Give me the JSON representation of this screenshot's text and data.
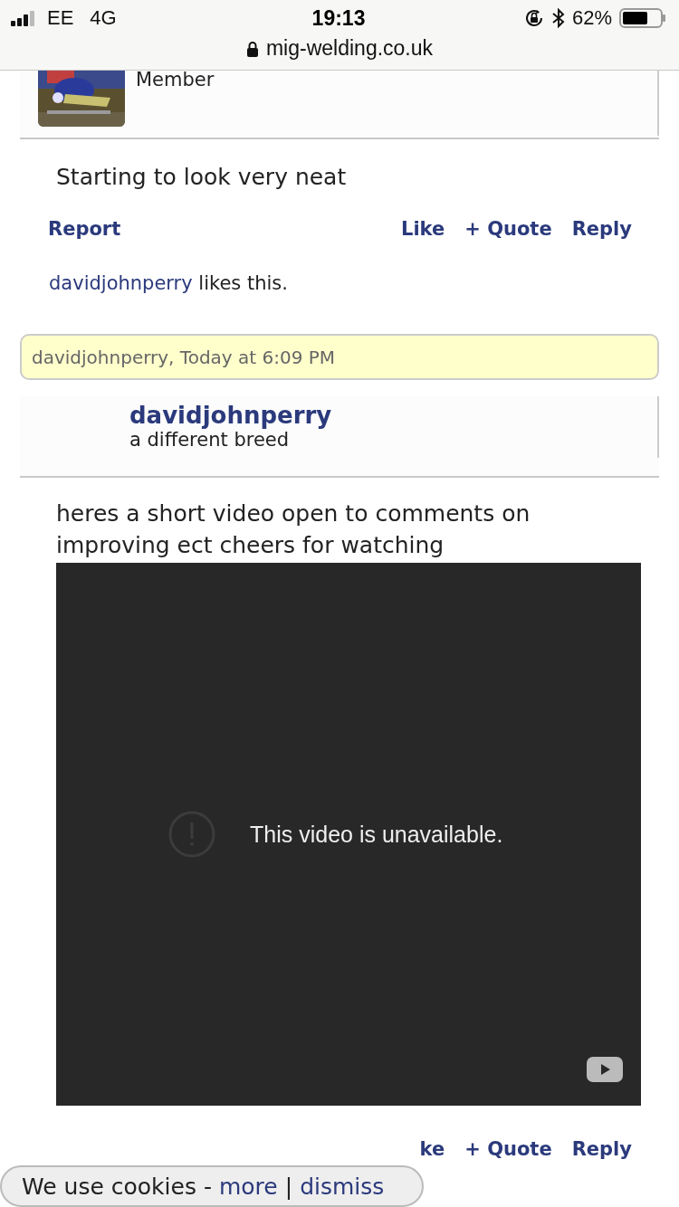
{
  "status_bar": {
    "carrier": "EE",
    "network": "4G",
    "time": "19:13",
    "battery": "62%",
    "url": "mig-welding.co.uk"
  },
  "first_post": {
    "member_title": "Member",
    "message": "Starting to look very neat",
    "actions_left": [
      "Report"
    ],
    "actions_right": [
      "Like",
      "+ Quote",
      "Reply"
    ],
    "liker": "davidjohnperry",
    "likes_text": "likes this."
  },
  "second_post": {
    "header": "davidjohnperry, Today at 6:09 PM",
    "username": "davidjohnperry",
    "user_title": "a different breed",
    "message": "heres a short video open to comments on improving ect cheers for watching",
    "video_message": "This video is unavailable.",
    "actions": [
      "ke",
      "+ Quote",
      "Reply"
    ]
  },
  "cookie_notice": {
    "text": "We use cookies -",
    "more": "more",
    "separator": "|",
    "dismiss": "dismiss"
  }
}
